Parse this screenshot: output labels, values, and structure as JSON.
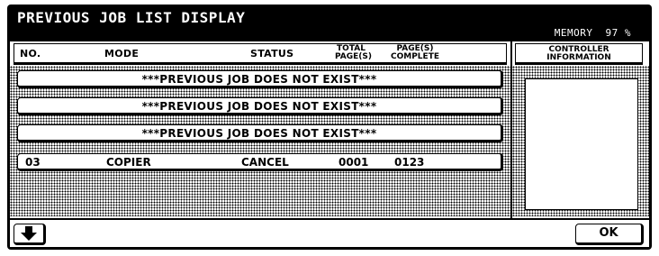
{
  "window": {
    "title": "PREVIOUS JOB LIST DISPLAY",
    "memory_label": "MEMORY",
    "memory_value": "97 %"
  },
  "columns": {
    "no": "NO.",
    "mode": "MODE",
    "status": "STATUS",
    "total_pages_line1": "TOTAL",
    "total_pages_line2": "PAGE(S)",
    "pages_complete_line1": "PAGE(S)",
    "pages_complete_line2": "COMPLETE",
    "controller_line1": "CONTROLLER",
    "controller_line2": "INFORMATION"
  },
  "jobs": [
    {
      "message": "***PREVIOUS JOB DOES NOT EXIST***"
    },
    {
      "message": "***PREVIOUS JOB DOES NOT EXIST***"
    },
    {
      "message": "***PREVIOUS JOB DOES NOT EXIST***"
    },
    {
      "no": "03",
      "mode": "COPIER",
      "status": "CANCEL",
      "total_pages": "0001",
      "pages_complete": "0123"
    }
  ],
  "buttons": {
    "down_icon": "arrow-down-icon",
    "ok_label": "OK"
  }
}
